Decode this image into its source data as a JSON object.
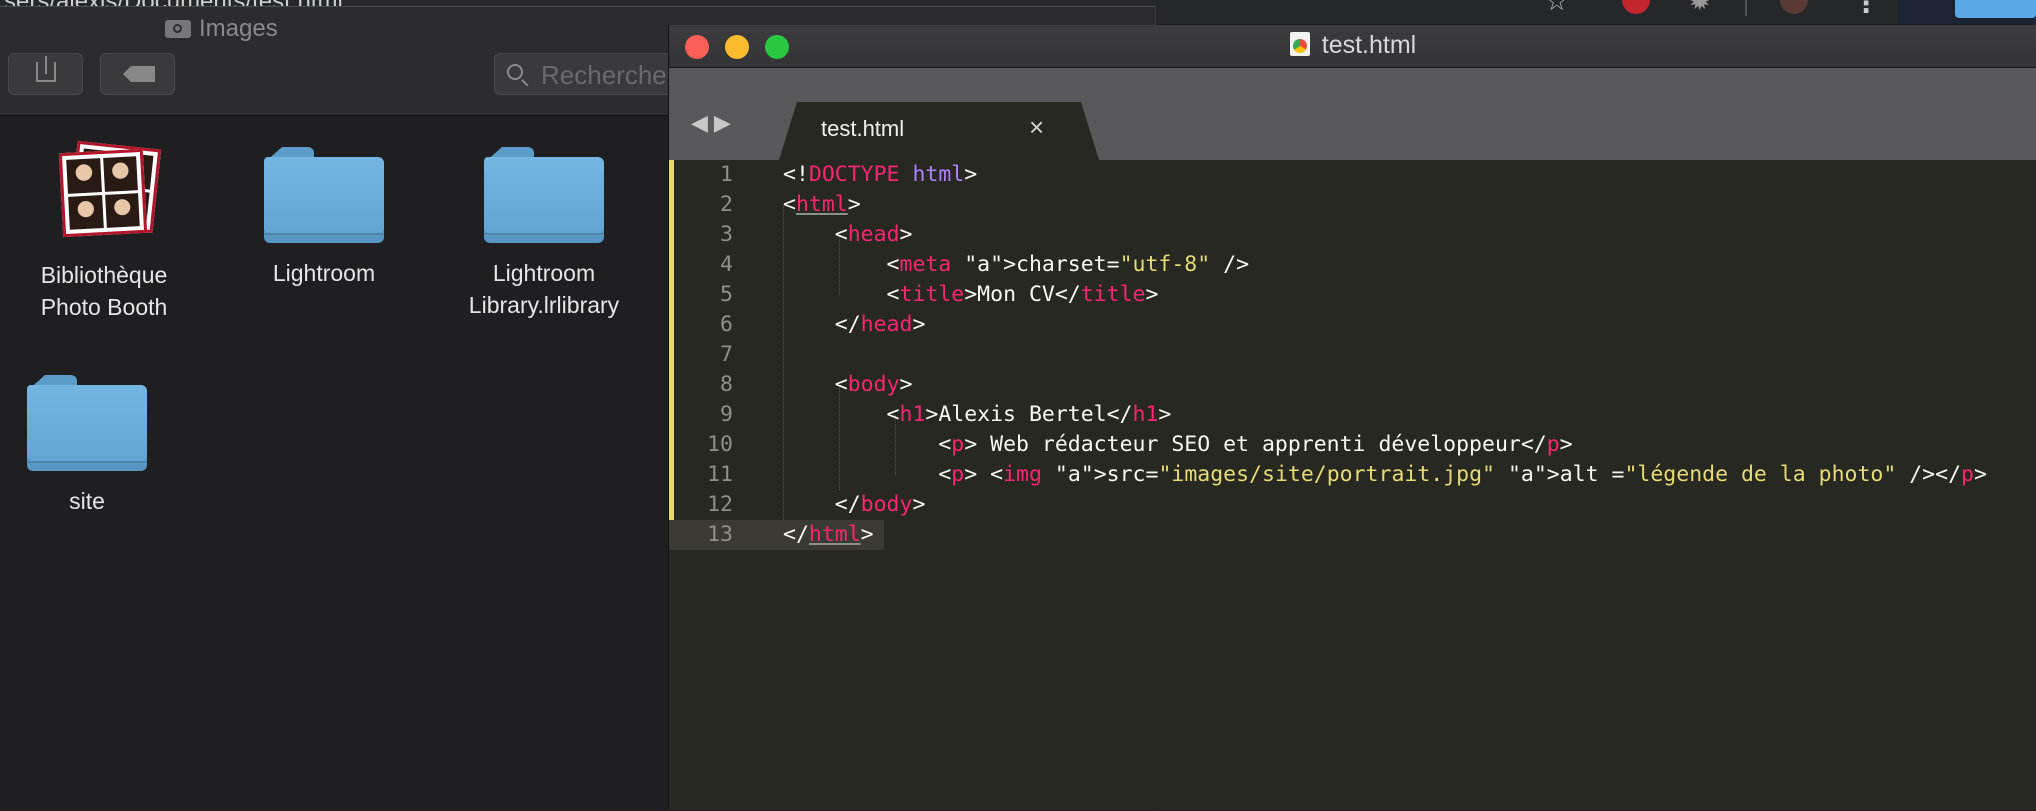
{
  "background_browser": {
    "url_fragment": "sers/alexis/Documents/test.html",
    "icons": [
      "star-icon",
      "adblock-icon",
      "gear-icon",
      "avatar-icon",
      "more-menu-icon"
    ]
  },
  "finder": {
    "title": "Images",
    "search_placeholder": "Rechercher",
    "items": [
      {
        "name_line1": "Bibliothèque",
        "name_line2": "Photo Booth",
        "icon": "photobooth-library-icon"
      },
      {
        "name_line1": "Lightroom",
        "name_line2": "",
        "icon": "folder-icon"
      },
      {
        "name_line1": "Lightroom",
        "name_line2": "Library.lrlibrary",
        "icon": "folder-icon"
      },
      {
        "name_line1": "site",
        "name_line2": "",
        "icon": "folder-icon"
      }
    ]
  },
  "editor": {
    "window_title": "test.html",
    "tab_label": "test.html",
    "tab_close": "×",
    "code_lines": [
      {
        "n": "1",
        "text": "<!DOCTYPE html>"
      },
      {
        "n": "2",
        "text": "<html>"
      },
      {
        "n": "3",
        "text": "    <head>"
      },
      {
        "n": "4",
        "text": "        <meta charset=\"utf-8\" />"
      },
      {
        "n": "5",
        "text": "        <title>Mon CV</title>"
      },
      {
        "n": "6",
        "text": "    </head>"
      },
      {
        "n": "7",
        "text": ""
      },
      {
        "n": "8",
        "text": "    <body>"
      },
      {
        "n": "9",
        "text": "        <h1>Alexis Bertel</h1>"
      },
      {
        "n": "10",
        "text": "            <p> Web rédacteur SEO et apprenti développeur</p>"
      },
      {
        "n": "11",
        "text": "            <p> <img src=\"images/site/portrait.jpg\" alt =\"légende de la photo\" /></p>"
      },
      {
        "n": "12",
        "text": "    </body>"
      },
      {
        "n": "13",
        "text": "</html>"
      }
    ],
    "current_line": "13",
    "colors": {
      "background": "#272822",
      "tag": "#f92672",
      "attr": "#a6e22e",
      "string": "#e6db74",
      "keyword": "#ae81ff",
      "text": "#f8f8f2"
    }
  }
}
